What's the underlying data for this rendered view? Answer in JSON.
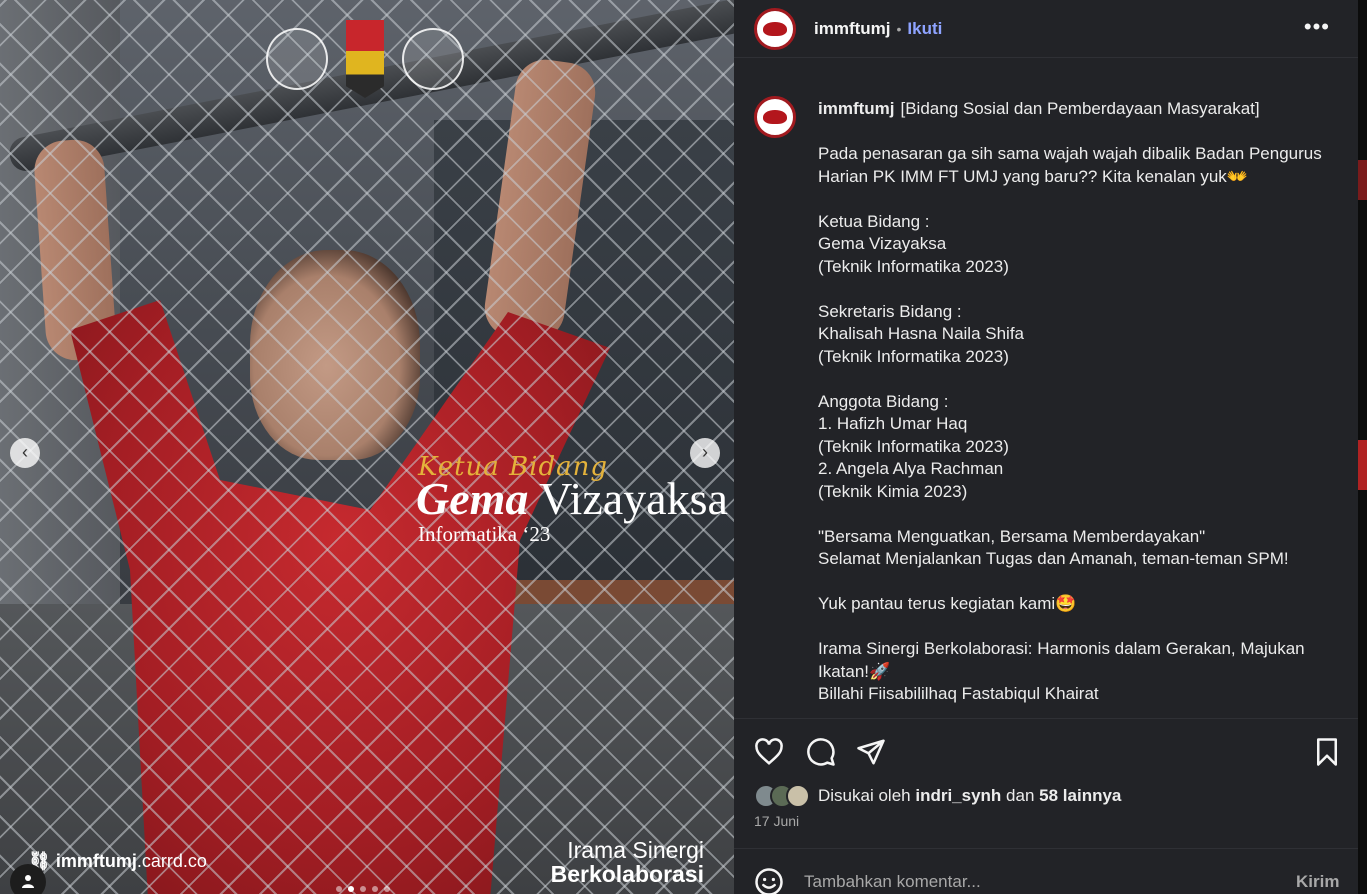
{
  "media": {
    "overlay": {
      "role": "Ketua Bidang",
      "name_first": "Gema",
      "name_last": "Vizayaksa",
      "major": "Informatika ‘23",
      "site_user": "immftumj",
      "site_domain": ".carrd.co",
      "tagline_1": "Irama Sinergi",
      "tagline_2": "Berkolaborasi"
    },
    "nav_prev_icon": "chevron-left-icon",
    "nav_next_icon": "chevron-right-icon",
    "carousel": {
      "count": 5,
      "active": 2
    }
  },
  "header": {
    "username": "immftumj",
    "separator": "•",
    "follow_label": "Ikuti",
    "more_label": "•••"
  },
  "post": {
    "username": "immftumj",
    "caption": "[Bidang Sosial dan Pemberdayaan Masyarakat]\n\nPada penasaran ga sih sama wajah wajah dibalik Badan Pengurus Harian PK IMM FT UMJ yang baru?? Kita kenalan yuk👐\n\nKetua Bidang :\nGema Vizayaksa\n(Teknik Informatika 2023)\n\nSekretaris Bidang :\nKhalisah Hasna Naila Shifa\n(Teknik Informatika 2023)\n\nAnggota Bidang :\n1. Hafizh Umar Haq\n(Teknik Informatika 2023)\n2. Angela Alya Rachman\n(Teknik Kimia 2023)\n\n\"Bersama Menguatkan, Bersama Memberdayakan\"\nSelamat Menjalankan Tugas dan Amanah, teman-teman SPM!\n\nYuk pantau terus kegiatan kami🤩\n\nIrama Sinergi Berkolaborasi: Harmonis dalam Gerakan, Majukan Ikatan!🚀\nBillahi Fiisabililhaq Fastabiqul Khairat"
  },
  "likes": {
    "prefix": "Disukai oleh",
    "user": "indri_synh",
    "connector": "dan",
    "others": "58 lainnya"
  },
  "date": "17 Juni",
  "comment_box": {
    "placeholder": "Tambahkan komentar...",
    "post_label": "Kirim"
  },
  "colors": {
    "panel_bg": "#222327",
    "accent_link": "#8ea3ff",
    "brand_red": "#a11a1f"
  }
}
